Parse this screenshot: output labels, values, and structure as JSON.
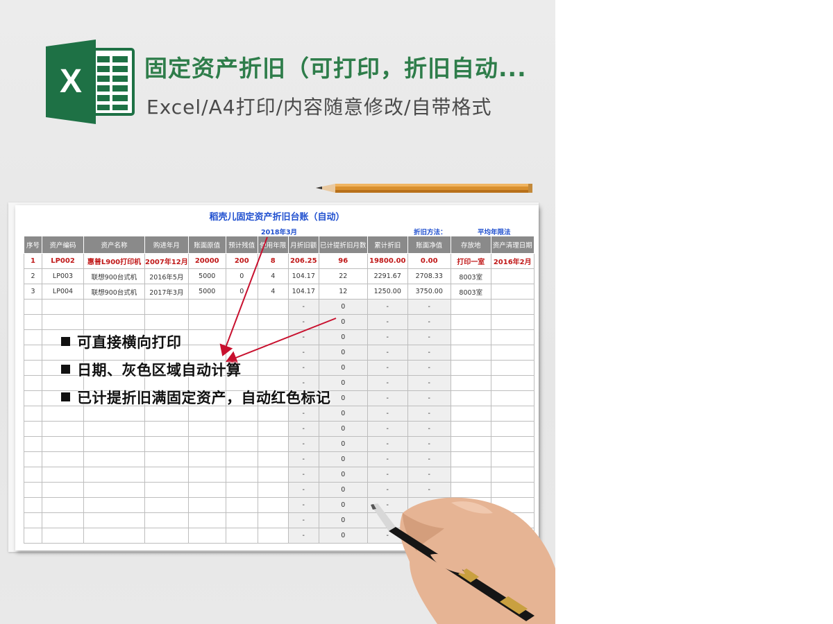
{
  "header": {
    "title": "固定资产折旧（可打印，折旧自动...",
    "subtitle": "Excel/A4打印/内容随意修改/自带格式",
    "logo_letter": "X",
    "brand_color": "#1e7145"
  },
  "sheet": {
    "title": "稻壳儿固定资产折旧台账（自动）",
    "date": "2018年3月",
    "method_label": "折旧方法：",
    "method_value": "平均年限法",
    "columns": [
      "序号",
      "资产编码",
      "资产名称",
      "购进年月",
      "账面原值",
      "预计残值",
      "使用年限",
      "月折旧额",
      "已计提折旧月数",
      "累计折旧",
      "账面净值",
      "存放地",
      "资产清理日期"
    ],
    "rows": [
      [
        "1",
        "LP002",
        "惠普L900打印机",
        "2007年12月",
        "20000",
        "200",
        "8",
        "206.25",
        "96",
        "19800.00",
        "0.00",
        "打印一室",
        "2016年2月"
      ],
      [
        "2",
        "LP003",
        "联想900台式机",
        "2016年5月",
        "5000",
        "0",
        "4",
        "104.17",
        "22",
        "2291.67",
        "2708.33",
        "8003室",
        ""
      ],
      [
        "3",
        "LP004",
        "联想900台式机",
        "2017年3月",
        "5000",
        "0",
        "4",
        "104.17",
        "12",
        "1250.00",
        "3750.00",
        "8003室",
        ""
      ]
    ],
    "empty_row": [
      "",
      "",
      "",
      "",
      "",
      "",
      "",
      "-",
      "0",
      "-",
      "-",
      "",
      ""
    ],
    "full_depreciation_color": "#c01818",
    "accent_blue": "#1f4fcf"
  },
  "bullets": [
    "可直接横向打印",
    "日期、灰色区域自动计算",
    "已计提折旧满固定资产，自动红色标记"
  ]
}
